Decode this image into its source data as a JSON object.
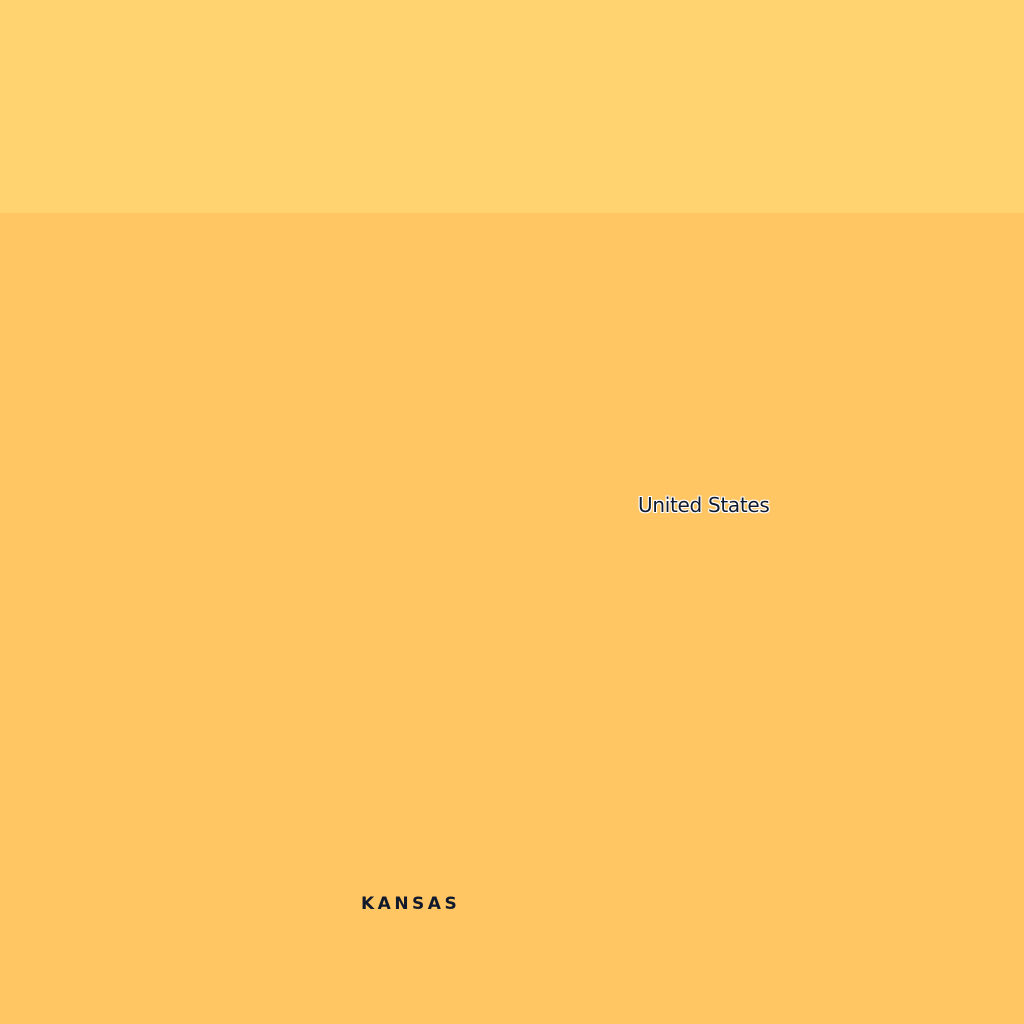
{
  "map": {
    "colors": {
      "north_region_fill": "#ffd36f",
      "main_region_fill": "#ffc663",
      "label_text": "#111a2c",
      "label_halo": "#ffffff"
    },
    "labels": {
      "country": "United States",
      "state": "KANSAS"
    }
  }
}
